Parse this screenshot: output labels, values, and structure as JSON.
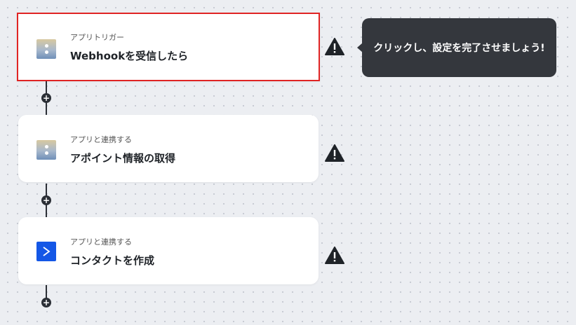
{
  "flow": {
    "steps": [
      {
        "subtitle": "アプリトリガー",
        "title": "Webhookを受信したら",
        "icon": "webhook-icon",
        "selected": true
      },
      {
        "subtitle": "アプリと連携する",
        "title": "アポイント情報の取得",
        "icon": "webhook-icon",
        "selected": false
      },
      {
        "subtitle": "アプリと連携する",
        "title": "コンタクトを作成",
        "icon": "chevron-right-icon",
        "selected": false
      }
    ],
    "add_label": "+"
  },
  "tooltip": {
    "text": "クリックし、設定を完了させましょう!"
  },
  "colors": {
    "selected_border": "#e02424",
    "tooltip_bg": "#34373d",
    "connector": "#2b2f36",
    "app_blue": "#1457e6"
  }
}
